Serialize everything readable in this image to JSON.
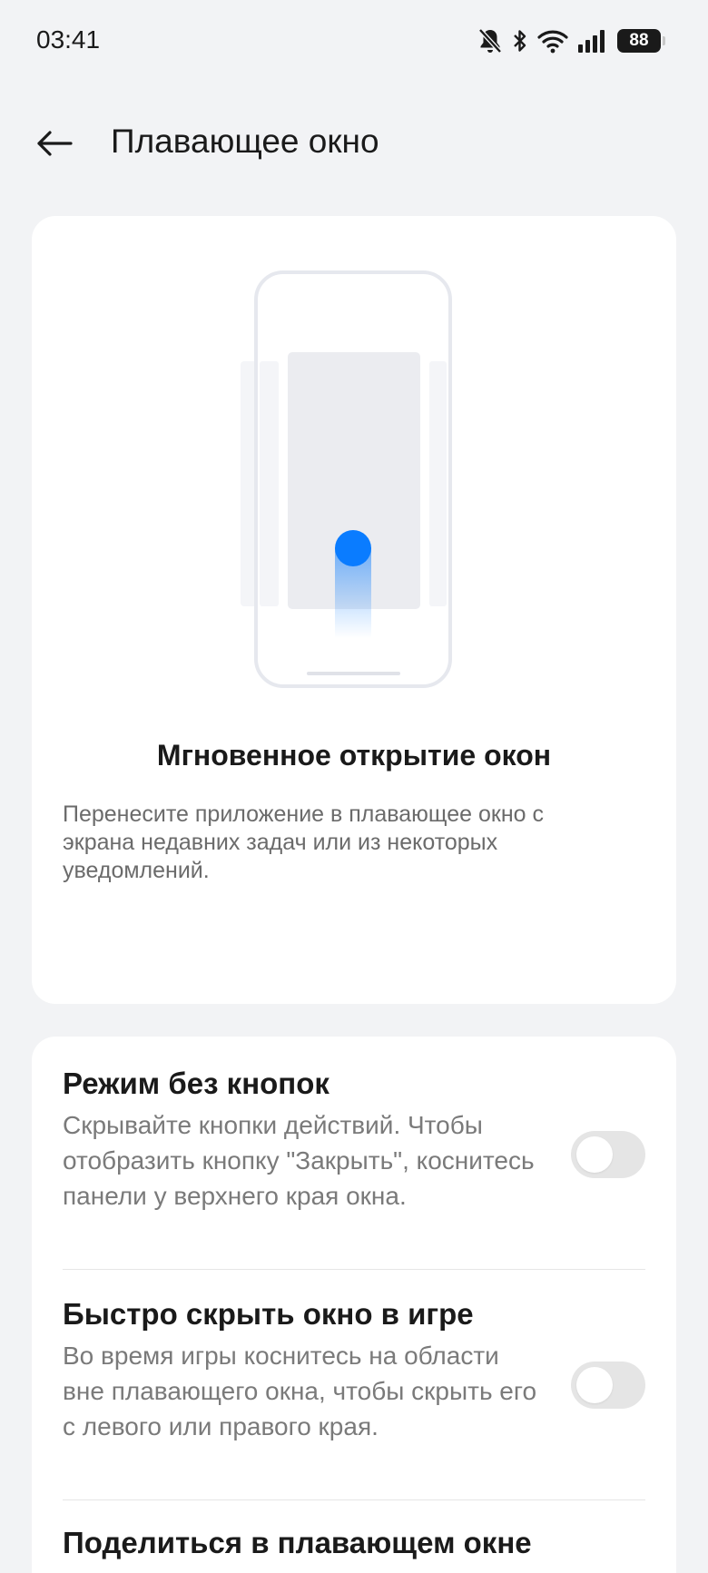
{
  "status_bar": {
    "time": "03:41",
    "battery": "88",
    "icons": [
      "bell-muted-icon",
      "bluetooth-icon",
      "wifi-icon",
      "signal-icon",
      "battery-icon"
    ]
  },
  "app_bar": {
    "back_icon": "arrow-left-icon",
    "title": "Плавающее окно"
  },
  "intro_card": {
    "title": "Мгновенное открытие окон",
    "description": "Перенесите приложение в плавающее окно с экрана недавних задач или из некоторых уведомлений.",
    "pager": {
      "count": 6,
      "active_index": 0
    },
    "accent_color": "#0a7cff"
  },
  "settings": [
    {
      "title": "Режим без кнопок",
      "description": "Скрывайте кнопки действий. Чтобы отобразить кнопку \"Закрыть\", коснитесь панели у верхнего края окна.",
      "enabled": false
    },
    {
      "title": "Быстро скрыть окно в игре",
      "description": "Во время игры коснитесь на области вне плавающего окна, чтобы скрыть его с левого или правого края.",
      "enabled": false
    },
    {
      "title": "Поделиться в плавающем окне"
    }
  ]
}
